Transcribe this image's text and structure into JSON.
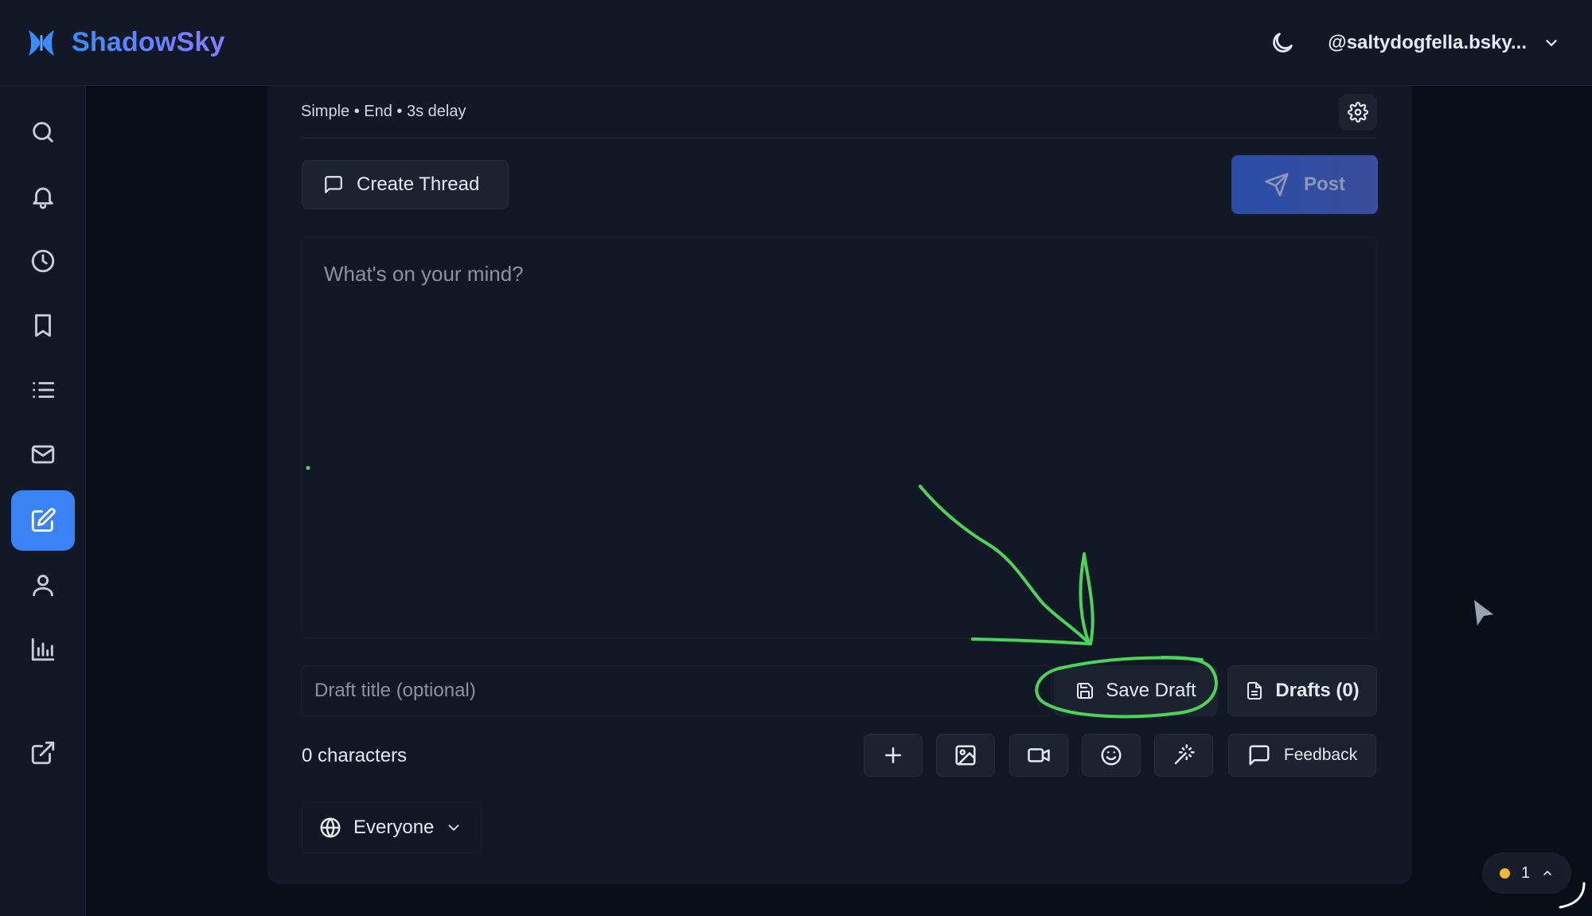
{
  "app": {
    "name": "ShadowSky",
    "account": "@saltydogfella.bsky..."
  },
  "icons": {
    "theme": "moon-icon",
    "account_menu": "chevron-down-icon",
    "sidebar": [
      "search-icon",
      "bell-icon",
      "clock-icon",
      "bookmark-icon",
      "list-icon",
      "mail-icon",
      "edit-icon",
      "user-icon",
      "bar-chart-icon",
      "external-link-icon"
    ]
  },
  "sidebar": {
    "active_index": 6
  },
  "composer": {
    "meta": "Simple • End • 3s delay",
    "create_thread": "Create Thread",
    "post": "Post",
    "placeholder": "What's on your mind?",
    "value": "",
    "draft_title_placeholder": "Draft title (optional)",
    "save_draft": "Save Draft",
    "drafts": "Drafts (0)",
    "char_count": "0 characters",
    "feedback": "Feedback",
    "audience": "Everyone"
  },
  "status": {
    "count": "1"
  },
  "colors": {
    "accent": "#3b82f6",
    "annotation": "#4cd35a",
    "status_dot": "#f5b731",
    "background": "#0a0e17",
    "surface": "#121826"
  }
}
